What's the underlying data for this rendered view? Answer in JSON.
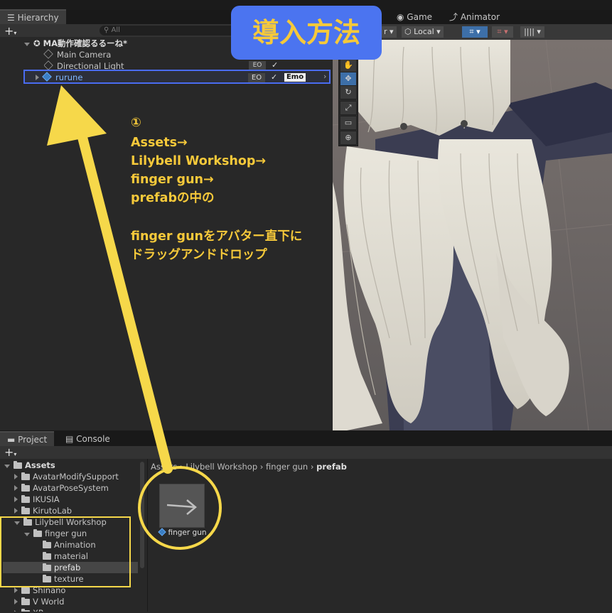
{
  "title_badge": "導入方法",
  "hierarchy": {
    "tab": "Hierarchy",
    "add": "+",
    "search_placeholder": "All",
    "scene": "MA動作確認るるーね*",
    "items": [
      {
        "label": "Main Camera"
      },
      {
        "label": "Directional Light",
        "tag": "EO",
        "check": "✓"
      },
      {
        "label": "rurune",
        "tag": "EO",
        "check": "✓",
        "extra": "Emo",
        "chev": "›"
      }
    ]
  },
  "scene_view": {
    "tabs": [
      "Game",
      "Animator"
    ],
    "pivot_label": "r",
    "local_label": "Local",
    "tool_icons": [
      "✋",
      "✥",
      "↻",
      "⤢",
      "▭",
      "⊕"
    ]
  },
  "annotation": {
    "step": "①",
    "lines": [
      "Assets→",
      "Lilybell Workshop→",
      "finger gun→",
      "prefabの中の",
      "",
      "finger gunをアバター直下に",
      "ドラッグアンドドロップ"
    ]
  },
  "project": {
    "tabs": [
      "Project",
      "Console"
    ],
    "add": "+",
    "tree": [
      {
        "label": "Assets",
        "level": 0,
        "open": true
      },
      {
        "label": "AvatarModifySupport",
        "level": 1
      },
      {
        "label": "AvatarPoseSystem",
        "level": 1
      },
      {
        "label": "IKUSIA",
        "level": 1
      },
      {
        "label": "KirutoLab",
        "level": 1
      },
      {
        "label": "Lilybell Workshop",
        "level": 1,
        "open": true
      },
      {
        "label": "finger gun",
        "level": 2,
        "open": true
      },
      {
        "label": "Animation",
        "level": 3
      },
      {
        "label": "material",
        "level": 3
      },
      {
        "label": "prefab",
        "level": 3,
        "selected": true
      },
      {
        "label": "texture",
        "level": 3
      },
      {
        "label": "Shinano",
        "level": 1
      },
      {
        "label": "V World",
        "level": 1
      },
      {
        "label": "XR",
        "level": 1
      }
    ],
    "breadcrumb": [
      "Assets",
      "Lilybell Workshop",
      "finger gun",
      "prefab"
    ],
    "asset": {
      "label": "finger gun"
    }
  },
  "colors": {
    "annotation": "#f6d84a",
    "highlight_blue": "#4a6cf0",
    "badge_bg": "#4b74f0",
    "badge_text": "#f6c93a"
  }
}
